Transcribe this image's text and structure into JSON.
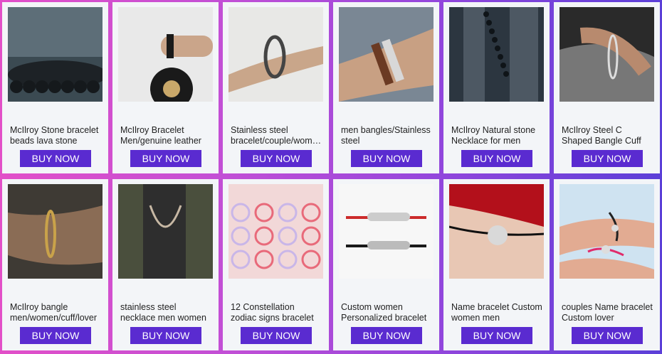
{
  "products": [
    {
      "title": "McIlroy Stone bracelet beads lava stone",
      "button": "BUY NOW",
      "image": "stone-bead-bracelet-photo",
      "palette": [
        "#3b4a52",
        "#5d6e78",
        "#1d2226"
      ]
    },
    {
      "title": "McIlroy Bracelet Men/genuine leather",
      "button": "BUY NOW",
      "image": "leather-bracelet-steering-wheel-photo",
      "palette": [
        "#e9e9e9",
        "#1a1a1a",
        "#c9a86a"
      ]
    },
    {
      "title": "Stainless steel bracelet/couple/women",
      "button": "BUY NOW",
      "image": "steel-chain-bracelet-photo",
      "palette": [
        "#e8e8e6",
        "#c9a68a",
        "#444"
      ]
    },
    {
      "title": "men bangles/Stainless steel",
      "button": "BUY NOW",
      "image": "braided-bangles-photo",
      "palette": [
        "#7a8794",
        "#c8a083",
        "#6b3a23"
      ]
    },
    {
      "title": "McIlroy Natural stone Necklace for men",
      "button": "BUY NOW",
      "image": "stone-bead-necklace-photo",
      "palette": [
        "#2c3640",
        "#4d5863",
        "#0f1418"
      ]
    },
    {
      "title": "McIlroy Steel C Shaped Bangle Cuff",
      "button": "BUY NOW",
      "image": "c-shaped-bangle-photo",
      "palette": [
        "#2a2a2a",
        "#b88a6e",
        "#777"
      ]
    },
    {
      "title": "McIlroy bangle men/women/cuff/lover",
      "button": "BUY NOW",
      "image": "gold-cuff-tattoo-arm-photo",
      "palette": [
        "#3e3a34",
        "#8a6c55",
        "#c9a24a"
      ]
    },
    {
      "title": "stainless steel necklace men women",
      "button": "BUY NOW",
      "image": "chain-necklace-photo",
      "palette": [
        "#4a4f3d",
        "#2e2e2e",
        "#c7b8a4"
      ]
    },
    {
      "title": "12 Constellation zodiac signs bracelet",
      "button": "BUY NOW",
      "image": "zodiac-bracelets-grid-photo",
      "palette": [
        "#f2d8d8",
        "#e86a7a",
        "#c9b6e8"
      ]
    },
    {
      "title": "Custom women Personalized bracelet",
      "button": "BUY NOW",
      "image": "together-forever-bracelet-card",
      "palette": [
        "#f7f7f7",
        "#cc2b2b",
        "#1a1a1a"
      ]
    },
    {
      "title": "Name bracelet Custom women men",
      "button": "BUY NOW",
      "image": "name-disc-bracelet-photo",
      "palette": [
        "#b3101b",
        "#e8c7b4",
        "#d9d9d9"
      ]
    },
    {
      "title": "couples Name bracelet Custom lover",
      "button": "BUY NOW",
      "image": "couples-name-bracelets-photo",
      "palette": [
        "#cfe3f1",
        "#e2ab92",
        "#e02b6b"
      ]
    }
  ]
}
